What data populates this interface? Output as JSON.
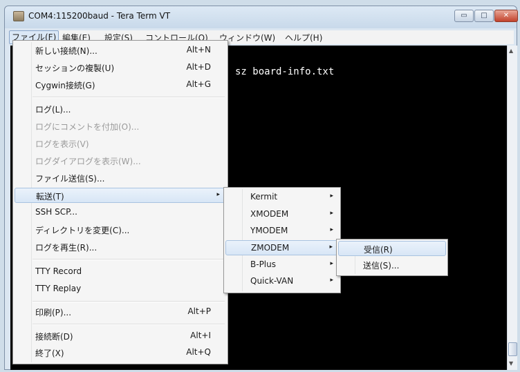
{
  "window": {
    "title": "COM4:115200baud - Tera Term VT"
  },
  "menubar": {
    "items": [
      {
        "label": "ファイル(F)"
      },
      {
        "label": "編集(E)"
      },
      {
        "label": "設定(S)"
      },
      {
        "label": "コントロール(O)"
      },
      {
        "label": "ウィンドウ(W)"
      },
      {
        "label": "ヘルプ(H)"
      }
    ]
  },
  "terminal": {
    "line1": "sz board-info.txt"
  },
  "file_menu": {
    "items": [
      {
        "label": "新しい接続(N)...",
        "shortcut": "Alt+N"
      },
      {
        "label": "セッションの複製(U)",
        "shortcut": "Alt+D"
      },
      {
        "label": "Cygwin接続(G)",
        "shortcut": "Alt+G"
      },
      {
        "label": "ログ(L)..."
      },
      {
        "label": "ログにコメントを付加(O)..."
      },
      {
        "label": "ログを表示(V)"
      },
      {
        "label": "ログダイアログを表示(W)..."
      },
      {
        "label": "ファイル送信(S)..."
      },
      {
        "label": "転送(T)"
      },
      {
        "label": "SSH SCP..."
      },
      {
        "label": "ディレクトリを変更(C)..."
      },
      {
        "label": "ログを再生(R)..."
      },
      {
        "label": "TTY Record"
      },
      {
        "label": "TTY Replay"
      },
      {
        "label": "印刷(P)...",
        "shortcut": "Alt+P"
      },
      {
        "label": "接続断(D)",
        "shortcut": "Alt+I"
      },
      {
        "label": "終了(X)",
        "shortcut": "Alt+Q"
      }
    ]
  },
  "transfer_menu": {
    "items": [
      {
        "label": "Kermit"
      },
      {
        "label": "XMODEM"
      },
      {
        "label": "YMODEM"
      },
      {
        "label": "ZMODEM"
      },
      {
        "label": "B-Plus"
      },
      {
        "label": "Quick-VAN"
      }
    ]
  },
  "zmodem_menu": {
    "items": [
      {
        "label": "受信(R)"
      },
      {
        "label": "送信(S)..."
      }
    ]
  },
  "icons": {
    "submenu_arrow": "▸",
    "minimize": "▭",
    "maximize": "□",
    "close": "✕",
    "scroll_up": "▲",
    "scroll_down": "▼"
  }
}
